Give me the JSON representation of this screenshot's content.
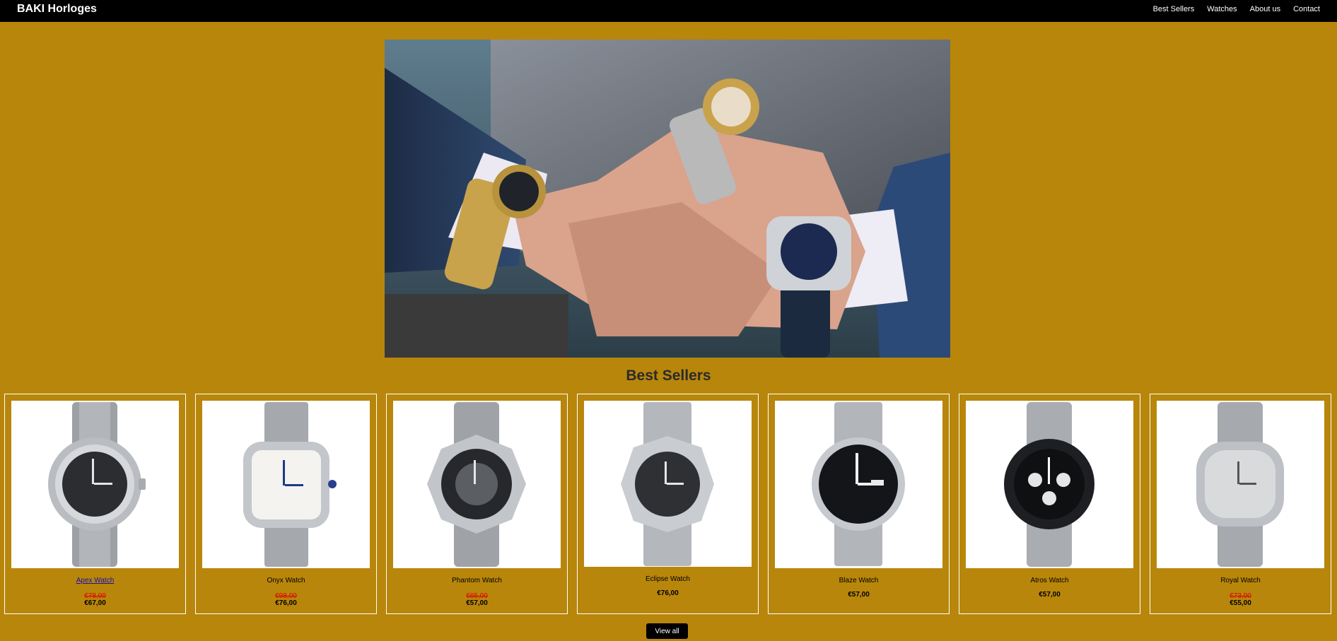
{
  "header": {
    "brand": "BAKI Horloges",
    "nav": [
      "Best Sellers",
      "Watches",
      "About us",
      "Contact"
    ]
  },
  "hero": {
    "alt": "Hands wearing luxury watches"
  },
  "best_sellers": {
    "title": "Best Sellers",
    "products": [
      {
        "name": "Apex Watch",
        "old_price": "€78,00",
        "price": "€67,00"
      },
      {
        "name": "Onyx Watch",
        "old_price": "€98,00",
        "price": "€76,00"
      },
      {
        "name": "Phantom Watch",
        "old_price": "€65,00",
        "price": "€57,00"
      },
      {
        "name": "Eclipse Watch",
        "old_price": "",
        "price": "€76,00"
      },
      {
        "name": "Blaze Watch",
        "old_price": "",
        "price": "€57,00"
      },
      {
        "name": "Atros Watch",
        "old_price": "",
        "price": "€57,00"
      },
      {
        "name": "Royal Watch",
        "old_price": "€73,00",
        "price": "€55,00"
      }
    ],
    "view_all": "View all"
  },
  "colors": {
    "background": "#b8860b",
    "header": "#000000",
    "sale": "#e00000"
  }
}
